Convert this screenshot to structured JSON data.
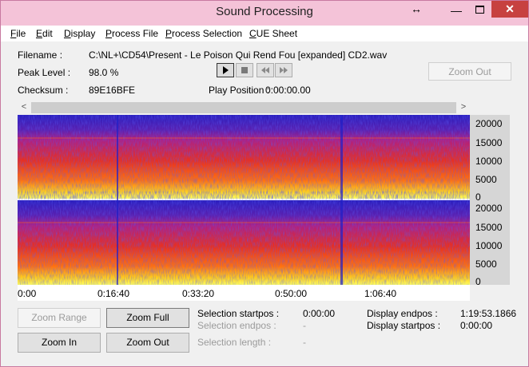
{
  "window": {
    "title": "Sound Processing",
    "resize_glyph": "↔",
    "minimize_glyph": "—",
    "close_glyph": "✕"
  },
  "menu": [
    {
      "label": "File"
    },
    {
      "label": "Edit"
    },
    {
      "label": "Display"
    },
    {
      "label": "Process File"
    },
    {
      "label": "Process Selection"
    },
    {
      "label": "CUE Sheet"
    }
  ],
  "info": {
    "filename_label": "Filename :",
    "filename_value": "C:\\NL+\\CD54\\Present - Le Poison Qui Rend Fou [expanded] CD2.wav",
    "peak_label": "Peak Level :",
    "peak_value": "98.0 %",
    "checksum_label": "Checksum :",
    "checksum_value": "89E16BFE",
    "play_position_label": "Play Position :",
    "play_position_value": "0:00:00.00"
  },
  "transport": [
    "play-icon",
    "stop-icon",
    "rewind-icon",
    "fast-forward-icon"
  ],
  "zoom_out_top_label": "Zoom Out",
  "frequency_axis": [
    "20000",
    "15000",
    "10000",
    "5000",
    "0"
  ],
  "time_axis": [
    "0:00",
    "0:16:40",
    "0:33:20",
    "0:50:00",
    "1:06:40"
  ],
  "buttons": {
    "zoom_range": "Zoom Range",
    "zoom_full": "Zoom Full",
    "zoom_in": "Zoom In",
    "zoom_out": "Zoom Out"
  },
  "selection": {
    "startpos_label": "Selection startpos :",
    "startpos_value": "0:00:00",
    "endpos_label": "Selection endpos :",
    "endpos_value": "-",
    "length_label": "Selection length :",
    "length_value": "-"
  },
  "display": {
    "endpos_label": "Display endpos :",
    "endpos_value": "1:19:53.1866",
    "startpos_label": "Display startpos :",
    "startpos_value": "0:00:00"
  },
  "colors": {
    "title_bar": "#f4c3d8",
    "close_button": "#c74140",
    "spectrogram_low": "#2020c8",
    "spectrogram_high": "#ffff40"
  }
}
